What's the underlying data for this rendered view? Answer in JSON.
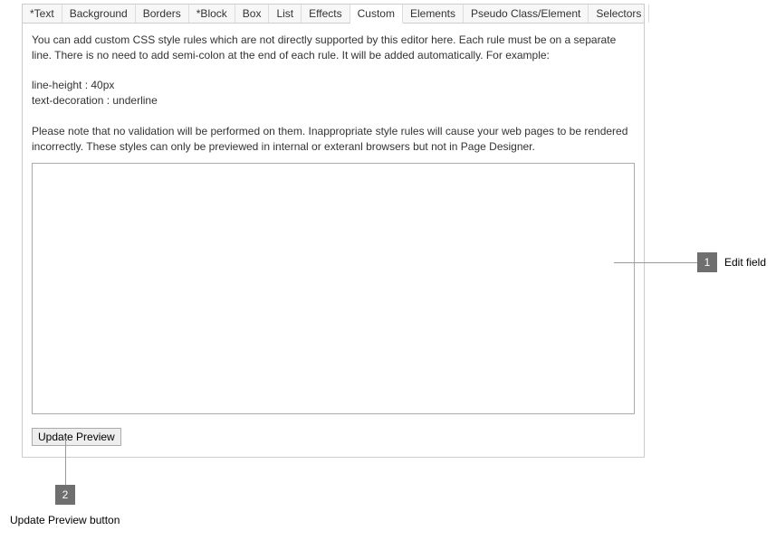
{
  "tabs": {
    "items": [
      {
        "label": "*Text"
      },
      {
        "label": "Background"
      },
      {
        "label": "Borders"
      },
      {
        "label": "*Block"
      },
      {
        "label": "Box"
      },
      {
        "label": "List"
      },
      {
        "label": "Effects"
      },
      {
        "label": "Custom"
      },
      {
        "label": "Elements"
      },
      {
        "label": "Pseudo Class/Element"
      },
      {
        "label": "Selectors"
      }
    ],
    "activeIndex": 7
  },
  "instructions": "You can add custom CSS style rules which are not directly supported by this editor here. Each rule must be on a separate line. There is no need to add semi-colon at the end of each rule. It will be added automatically. For example:\n\nline-height : 40px\ntext-decoration : underline\n\nPlease note that no validation will be performed on them. Inappropriate style rules will cause your web pages to be rendered incorrectly. These styles can only be previewed in internal or exteranl browsers but not in Page Designer.",
  "editField": {
    "value": ""
  },
  "buttons": {
    "updatePreview": "Update Preview"
  },
  "callouts": {
    "one": {
      "num": "1",
      "label": "Edit field"
    },
    "two": {
      "num": "2",
      "label": "Update Preview button"
    }
  }
}
